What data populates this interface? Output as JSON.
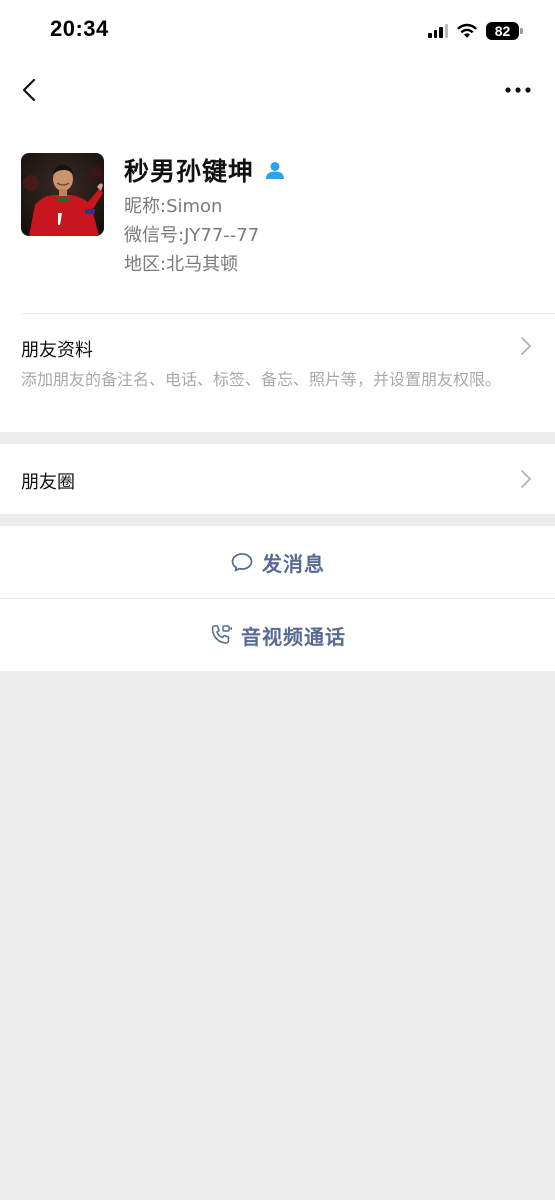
{
  "status_bar": {
    "time": "20:34",
    "battery": "82"
  },
  "nav": {
    "back_icon": "chevron-left-icon",
    "more_icon": "ellipsis-icon"
  },
  "profile": {
    "name": "秒男孙键坤",
    "nickname_label": "昵称:",
    "nickname": "Simon",
    "wechat_id_label": "微信号:",
    "wechat_id": "JY77--77",
    "region_label": "地区:",
    "region": "北马其顿"
  },
  "friend_info": {
    "title": "朋友资料",
    "description": "添加朋友的备注名、电话、标签、备忘、照片等，并设置朋友权限。"
  },
  "moments": {
    "title": "朋友圈"
  },
  "actions": {
    "message_label": "发消息",
    "call_label": "音视频通话"
  },
  "colors": {
    "link_blue": "#576b95",
    "friend_icon_blue": "#2aa2f2",
    "page_bg": "#ededed"
  }
}
